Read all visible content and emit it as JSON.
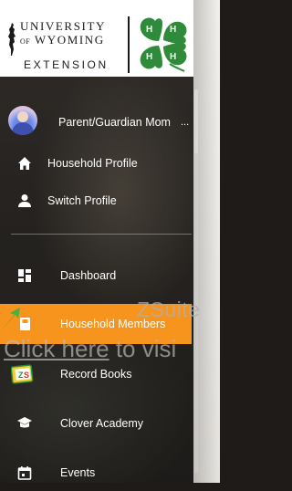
{
  "logo": {
    "line1": "UNIVERSITY",
    "line2_of": "OF",
    "line2": "WYOMING",
    "line3": "EXTENSION"
  },
  "profile": {
    "name": "Parent/Guardian Mom",
    "ellipsis": "..."
  },
  "top_items": [
    {
      "label": "Household Profile",
      "icon": "home-icon"
    },
    {
      "label": "Switch Profile",
      "icon": "person-icon"
    }
  ],
  "nav_items": [
    {
      "label": "Dashboard",
      "icon": "dashboard-icon"
    },
    {
      "label": "Household Members",
      "icon": "book-icon",
      "active": true
    },
    {
      "label": "Record Books",
      "icon": "record-books-icon"
    },
    {
      "label": "Clover Academy",
      "icon": "graduation-cap-icon"
    },
    {
      "label": "Events",
      "icon": "calendar-icon"
    }
  ],
  "overlay": {
    "zsuite_text": "ZSuite",
    "click_here": "Click here",
    "to_visit": " to visi"
  },
  "colors": {
    "active": "#f7941d",
    "clover_green": "#2e8b3a",
    "text": "#ffffff"
  }
}
